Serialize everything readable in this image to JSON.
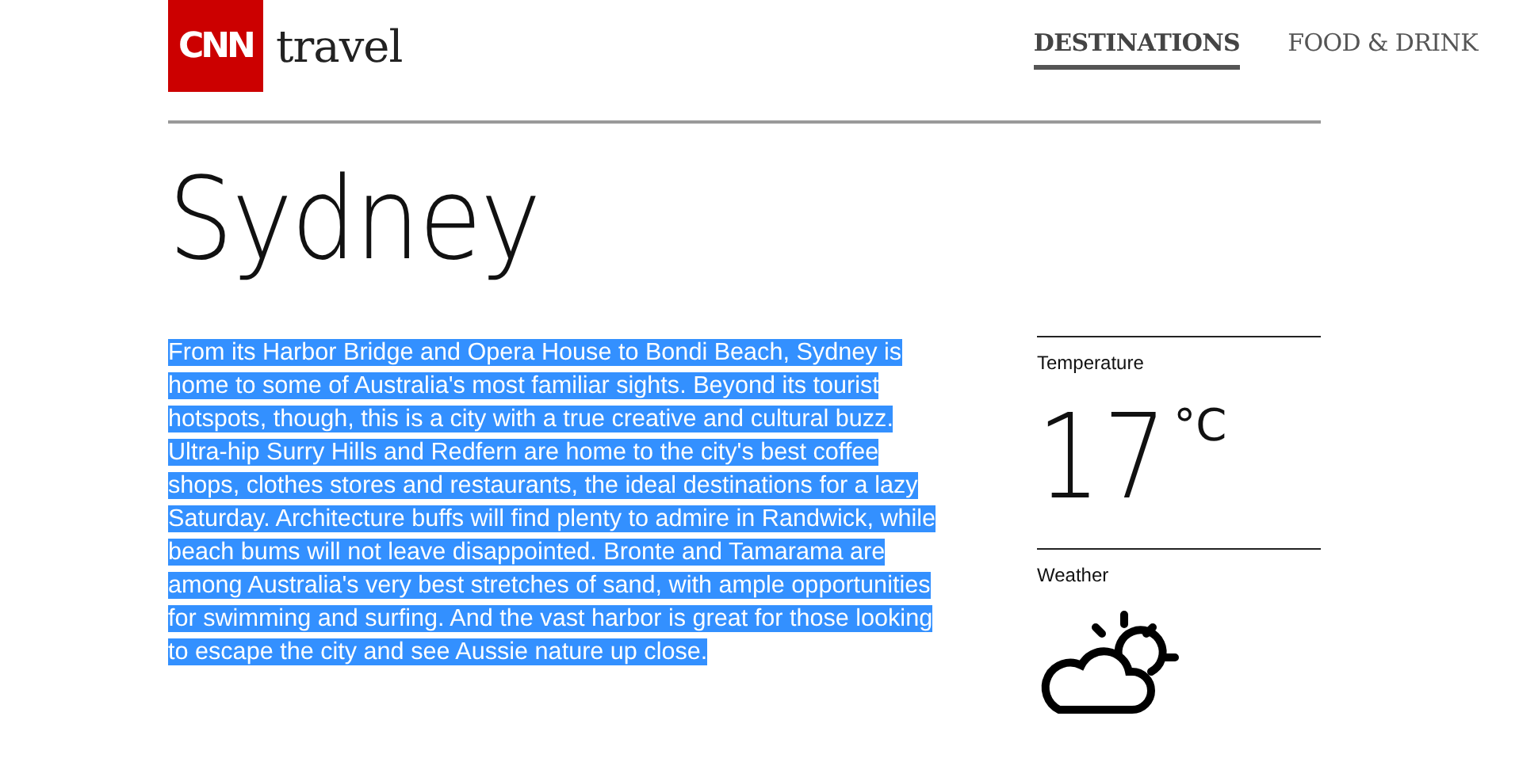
{
  "header": {
    "logo": "CNN",
    "section": "travel",
    "nav": [
      {
        "label": "DESTINATIONS",
        "selected": true
      },
      {
        "label": "FOOD & DRINK",
        "selected": false
      }
    ]
  },
  "city": {
    "title": "Sydney",
    "description": {
      "text": "From its Harbor Bridge and Opera House to Bondi Beach, Sydney is home to some of Australia's most familiar sights. Beyond its tourist hotspots, though, this is a city with a true creative and cultural buzz. Ultra-hip Surry Hills and Redfern are home to the city's best coffee shops, clothes stores and restaurants, the ideal destinations for a lazy Saturday. Architecture buffs will find plenty to admire in Randwick, while beach bums will not leave disappointed. Bronte and Tamarama are among Australia's very best stretches of sand, with ample opportunities for swimming and surfing. And the vast harbor is great for those looking to escape the city and see Aussie nature up close.",
      "selected": true
    }
  },
  "weather": {
    "temperature_label": "Temperature",
    "temperature": "17",
    "unit": "°C",
    "weather_label": "Weather"
  }
}
